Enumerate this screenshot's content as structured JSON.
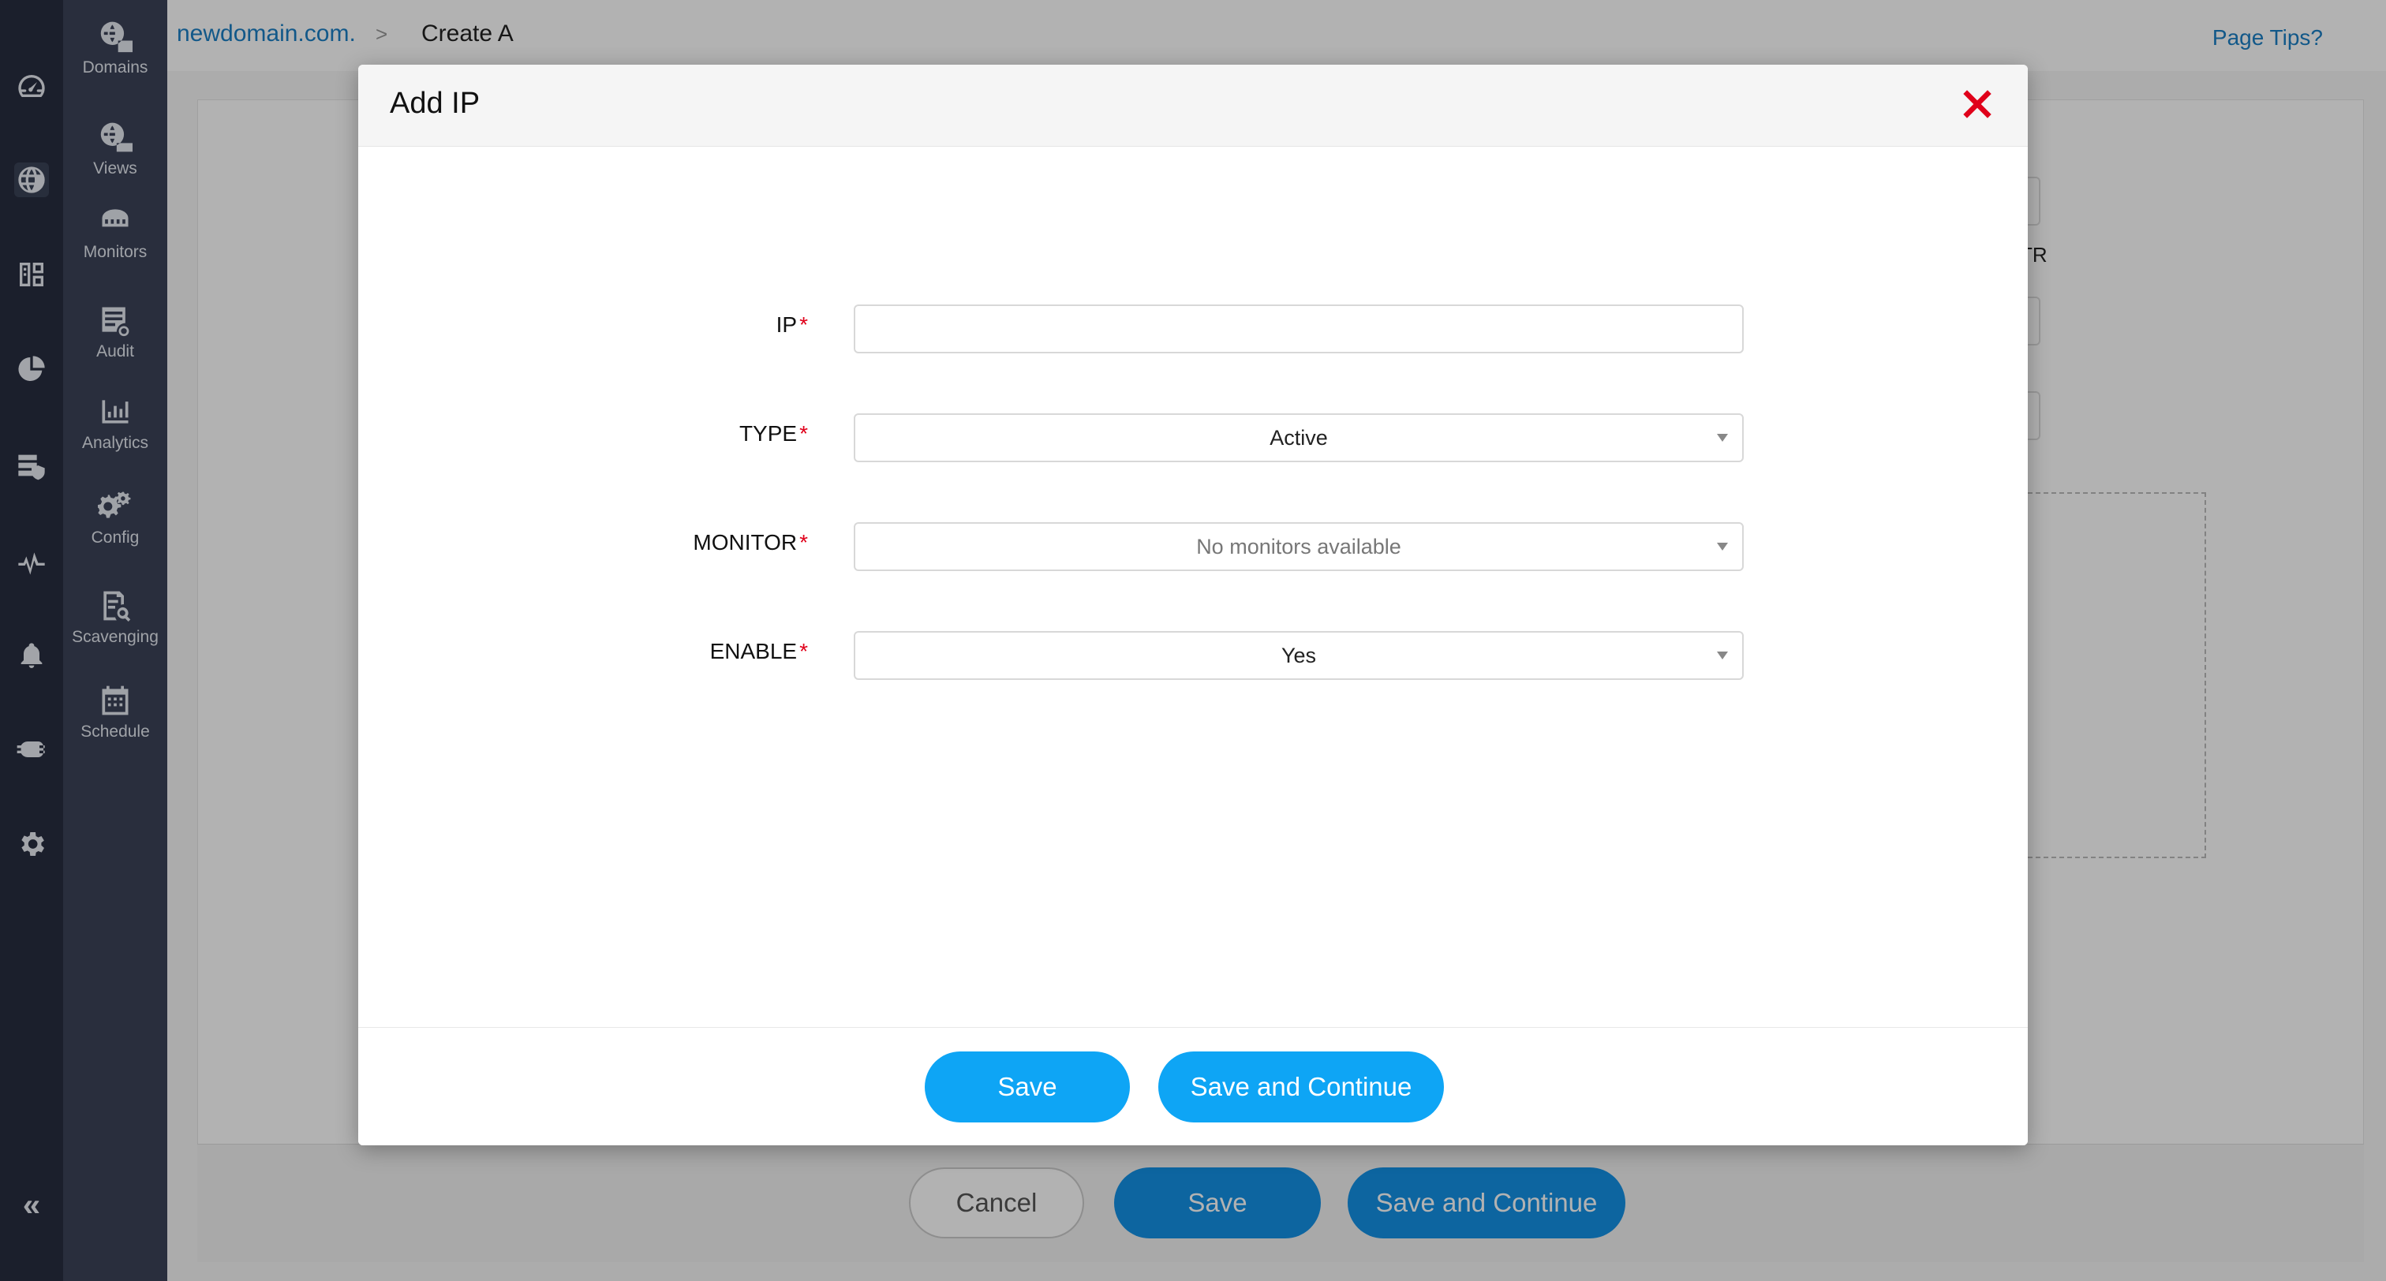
{
  "sidebar": {
    "items": [
      {
        "label": "Domains",
        "icon": "globe-com-icon"
      },
      {
        "label": "Views",
        "icon": "globe-views-icon"
      },
      {
        "label": "Monitors",
        "icon": "monitor-icon"
      },
      {
        "label": "Audit",
        "icon": "audit-icon"
      },
      {
        "label": "Analytics",
        "icon": "analytics-icon"
      },
      {
        "label": "Config",
        "icon": "config-icon"
      },
      {
        "label": "Scavenging",
        "icon": "scavenging-icon"
      },
      {
        "label": "Schedule",
        "icon": "schedule-icon"
      }
    ]
  },
  "header": {
    "breadcrumb_link": "newdomain.com.",
    "breadcrumb_separator": ">",
    "breadcrumb_current": "Create A",
    "page_tips": "Page Tips?"
  },
  "background_page": {
    "partial_text": "TR",
    "cancel_label": "Cancel",
    "save_label": "Save",
    "save_continue_label": "Save and Continue"
  },
  "modal": {
    "title": "Add IP",
    "fields": {
      "ip": {
        "label": "IP",
        "value": ""
      },
      "type": {
        "label": "TYPE",
        "value": "Active"
      },
      "monitor": {
        "label": "MONITOR",
        "value": "No monitors available"
      },
      "enable": {
        "label": "ENABLE",
        "value": "Yes"
      }
    },
    "required_marker": "*",
    "save_label": "Save",
    "save_continue_label": "Save and Continue"
  },
  "colors": {
    "primary_button": "#0ea5f5",
    "link": "#1b7fc4",
    "required": "#e0001a",
    "close": "#e0001a",
    "sidebar_dark": "#272d3f",
    "sidebar_sub": "#3b4258"
  }
}
